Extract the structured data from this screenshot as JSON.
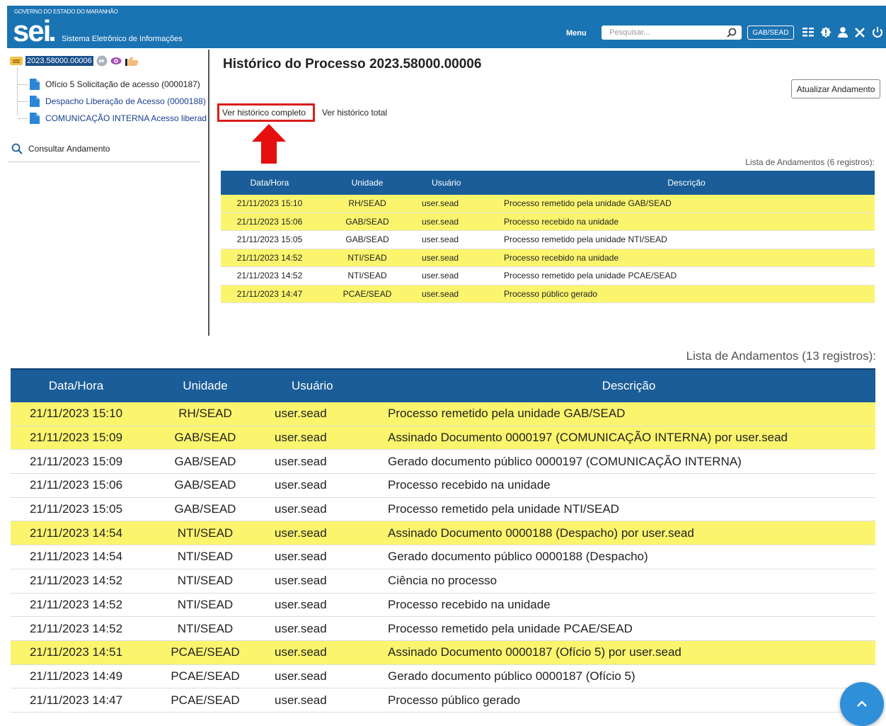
{
  "header": {
    "gov_text": "GOVERNO DO ESTADO DO MARANHÃO",
    "logo": "sei",
    "system_name": "Sistema Eletrônico de Informações",
    "menu_label": "Menu",
    "search_placeholder": "Pesquisar...",
    "unit_button": "GAB/SEAD",
    "icons": [
      "grid-icon",
      "alert-icon",
      "user-icon",
      "tools-icon",
      "power-icon"
    ],
    "bg_color": "#1a73b3"
  },
  "tree": {
    "process_number": "2023.58000.00006",
    "items": [
      {
        "label": "Ofício 5 Solicitação de acesso (0000187)",
        "color": "#222"
      },
      {
        "label": "Despacho Liberação de Acesso (0000188)",
        "color": "#1a3f8f"
      },
      {
        "label": "COMUNICAÇÃO INTERNA Acesso liberado",
        "color": "#1a3f8f"
      }
    ],
    "consult_label": "Consultar Andamento"
  },
  "page": {
    "title": "Histórico do Processo 2023.58000.00006",
    "update_button": "Atualizar Andamento",
    "link_full": "Ver histórico completo",
    "link_total": "Ver histórico total",
    "small_count": "Lista de Andamentos (6 registros):",
    "big_count": "Lista de Andamentos (13 registros):"
  },
  "columns": [
    "Data/Hora",
    "Unidade",
    "Usuário",
    "Descrição"
  ],
  "small_rows": [
    {
      "date": "21/11/2023 15:10",
      "unit": "RH/SEAD",
      "user": "user.sead",
      "desc": "Processo remetido pela unidade GAB/SEAD",
      "hl": true
    },
    {
      "date": "21/11/2023 15:06",
      "unit": "GAB/SEAD",
      "user": "user.sead",
      "desc": "Processo recebido na unidade",
      "hl": true
    },
    {
      "date": "21/11/2023 15:05",
      "unit": "GAB/SEAD",
      "user": "user.sead",
      "desc": "Processo remetido pela unidade NTI/SEAD",
      "hl": false
    },
    {
      "date": "21/11/2023 14:52",
      "unit": "NTI/SEAD",
      "user": "user.sead",
      "desc": "Processo recebido na unidade",
      "hl": true
    },
    {
      "date": "21/11/2023 14:52",
      "unit": "NTI/SEAD",
      "user": "user.sead",
      "desc": "Processo remetido pela unidade PCAE/SEAD",
      "hl": false
    },
    {
      "date": "21/11/2023 14:47",
      "unit": "PCAE/SEAD",
      "user": "user.sead",
      "desc": "Processo público gerado",
      "hl": true
    }
  ],
  "big_rows": [
    {
      "date": "21/11/2023 15:10",
      "unit": "RH/SEAD",
      "user": "user.sead",
      "desc": "Processo remetido pela unidade GAB/SEAD",
      "hl": true
    },
    {
      "date": "21/11/2023 15:09",
      "unit": "GAB/SEAD",
      "user": "user.sead",
      "desc": "Assinado Documento 0000197 (COMUNICAÇÃO INTERNA) por user.sead",
      "hl": true
    },
    {
      "date": "21/11/2023 15:09",
      "unit": "GAB/SEAD",
      "user": "user.sead",
      "desc": "Gerado documento público 0000197 (COMUNICAÇÃO INTERNA)",
      "hl": false
    },
    {
      "date": "21/11/2023 15:06",
      "unit": "GAB/SEAD",
      "user": "user.sead",
      "desc": "Processo recebido na unidade",
      "hl": false
    },
    {
      "date": "21/11/2023 15:05",
      "unit": "GAB/SEAD",
      "user": "user.sead",
      "desc": "Processo remetido pela unidade NTI/SEAD",
      "hl": false
    },
    {
      "date": "21/11/2023 14:54",
      "unit": "NTI/SEAD",
      "user": "user.sead",
      "desc": "Assinado Documento 0000188 (Despacho) por user.sead",
      "hl": true
    },
    {
      "date": "21/11/2023 14:54",
      "unit": "NTI/SEAD",
      "user": "user.sead",
      "desc": "Gerado documento público 0000188 (Despacho)",
      "hl": false
    },
    {
      "date": "21/11/2023 14:52",
      "unit": "NTI/SEAD",
      "user": "user.sead",
      "desc": "Ciência no processo",
      "hl": false
    },
    {
      "date": "21/11/2023 14:52",
      "unit": "NTI/SEAD",
      "user": "user.sead",
      "desc": "Processo recebido na unidade",
      "hl": false
    },
    {
      "date": "21/11/2023 14:52",
      "unit": "NTI/SEAD",
      "user": "user.sead",
      "desc": "Processo remetido pela unidade PCAE/SEAD",
      "hl": false
    },
    {
      "date": "21/11/2023 14:51",
      "unit": "PCAE/SEAD",
      "user": "user.sead",
      "desc": "Assinado Documento 0000187 (Ofício 5) por user.sead",
      "hl": true
    },
    {
      "date": "21/11/2023 14:49",
      "unit": "PCAE/SEAD",
      "user": "user.sead",
      "desc": "Gerado documento público 0000187 (Ofício 5)",
      "hl": false
    },
    {
      "date": "21/11/2023 14:47",
      "unit": "PCAE/SEAD",
      "user": "user.sead",
      "desc": "Processo público gerado",
      "hl": false
    }
  ],
  "colors": {
    "highlight": "#fbf56e",
    "table_header": "#1a5d98",
    "annotation_red": "#d81e1e",
    "fab": "#2f8fd9"
  }
}
